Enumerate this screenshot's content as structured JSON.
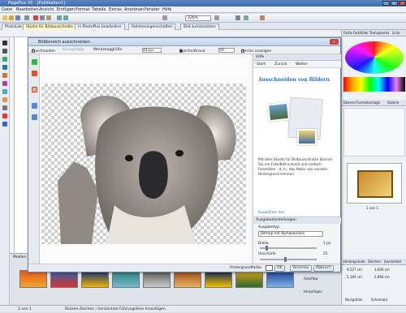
{
  "window": {
    "title": "PagePlus X5 - [Publikation1]"
  },
  "menu": [
    "Datei",
    "Bearbeiten",
    "Ansicht",
    "Einfügen",
    "Format",
    "Tabelle",
    "Extras",
    "Anordnen",
    "Fenster",
    "Hilfe"
  ],
  "toolbar": {
    "zoom": "226%"
  },
  "tabs": [
    "PhotoLab",
    "Studio für Bildausschnitte",
    "In PhotoPlus bearbeiten",
    "Rahmeneigenschaften",
    "Bild zurücksetzen"
  ],
  "dialog": {
    "title": "Bildbereich ausschneiden",
    "toolbar": {
      "keep": "Zuschneiden",
      "remove": "Rückgängig",
      "brush_label": "Werkzeuggröße",
      "brush_value": "44 px",
      "crop_label": "Zuschnittrand",
      "crop_value": "50",
      "outline_label": "Umriss anzeigen"
    },
    "help": {
      "header": "Hilfe",
      "nav": [
        "Start",
        "Zurück",
        "Weiter"
      ],
      "title": "Ausschneiden von Bildern",
      "text": "Mit dem Studio für Bildausschnitte können Sie ein Foto/Bild schnell und einfach freistellen - d. h., das Motiv von seinem Hintergrund trennen.",
      "link": "Auswählen des"
    },
    "settings": {
      "header": "Ausgabeeinstellungen",
      "type_label": "Ausgabetyp:",
      "type_value": "Bitmap mit Alphakanälen",
      "width_label": "Breite",
      "width_value": "1 px",
      "blur_label": "Unschärfe",
      "blur_value": "25",
      "width_pct": 0.1,
      "blur_pct": 0.45
    },
    "footer": {
      "bg": "Hintergrundfarbe",
      "ok": "OK",
      "preview": "Vorschau",
      "cancel": "Abbruch"
    }
  },
  "right_panel": {
    "tabs": [
      "Farbe",
      "Farbfüller",
      "Transparenz",
      "Linie"
    ],
    "tabs2": [
      "Ebenen",
      "Formatvorlage",
      "Galerie"
    ],
    "tabs3": [
      "Hintergründe",
      "Zeichen",
      "Ausrichten"
    ],
    "page_label": "1 von 1",
    "measures": [
      "9,527 cm",
      "3,649 cm",
      "5,184 cm",
      "2,860 cm"
    ],
    "nav": [
      "Navigation",
      "Schemata"
    ]
  },
  "gallery": {
    "label": "Medien",
    "buttons": [
      "Bilder einfügen",
      "Autoflow",
      "Hinzufügen"
    ]
  },
  "status": {
    "page": "1 von 1",
    "hint": "Rücken-Zeichen ; horizontale Führungslinie hinzufügen."
  },
  "colors": {
    "accent": "#2a6fb5",
    "tab_active": "#fff6c8",
    "title": "#3e6aa8"
  }
}
